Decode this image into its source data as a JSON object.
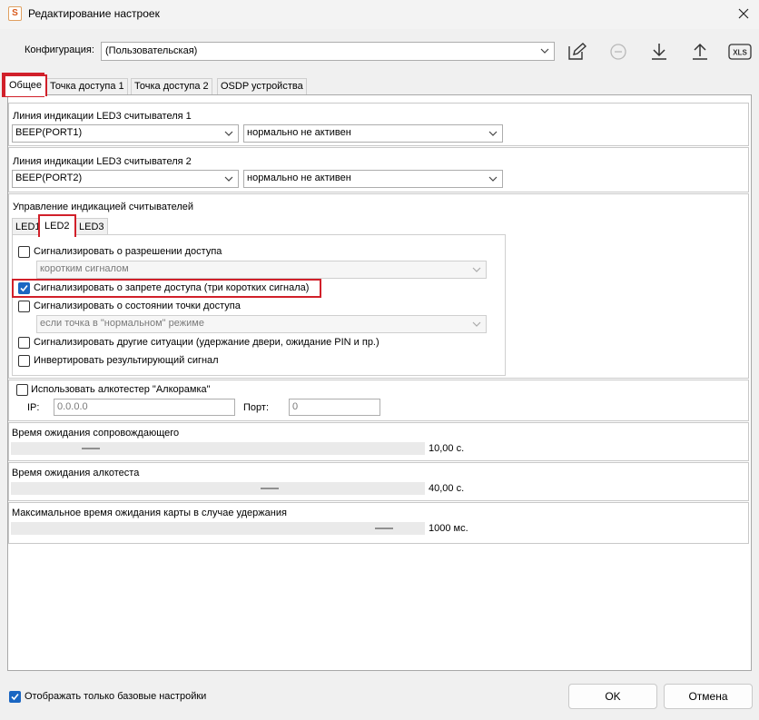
{
  "window": {
    "title": "Редактирование настроек",
    "icon_letter": "S"
  },
  "config": {
    "label": "Конфигурация:",
    "value": "(Пользовательская)"
  },
  "tabs": [
    {
      "label": "Общее"
    },
    {
      "label": "Точка доступа 1"
    },
    {
      "label": "Точка доступа 2"
    },
    {
      "label": "OSDP устройства"
    }
  ],
  "led_line1": {
    "label": "Линия индикации LED3 считывателя 1",
    "port": "BEEP(PORT1)",
    "state": "нормально не активен"
  },
  "led_line2": {
    "label": "Линия индикации LED3 считывателя 2",
    "port": "BEEP(PORT2)",
    "state": "нормально не активен"
  },
  "indication": {
    "label": "Управление индикацией считывателей",
    "subtabs": [
      {
        "label": "LED1"
      },
      {
        "label": "LED2"
      },
      {
        "label": "LED3"
      }
    ],
    "options": [
      {
        "label": "Сигнализировать о разрешении доступа",
        "checked": false
      },
      {
        "label": "Сигнализировать о запрете доступа (три коротких сигнала)",
        "checked": true
      },
      {
        "label": "Сигнализировать о состоянии точки доступа",
        "checked": false
      },
      {
        "label": "Сигнализировать другие ситуации (удержание двери, ожидание PIN и пр.)",
        "checked": false
      },
      {
        "label": "Инвертировать результирующий сигнал",
        "checked": false
      }
    ],
    "access_granted_mode": "коротким сигналом",
    "point_state_mode": "если точка в \"нормальном\" режиме"
  },
  "alco": {
    "checkbox_label": "Использовать алкотестер \"Алкорамка\"",
    "checked": false,
    "ip_label": "IP:",
    "ip_value": "0.0.0.0",
    "port_label": "Порт:",
    "port_value": "0"
  },
  "sliders": [
    {
      "label": "Время ожидания сопровождающего",
      "value": "10,00 с.",
      "level": 0.18
    },
    {
      "label": "Время ожидания алкотеста",
      "value": "40,00 с.",
      "level": 0.63
    },
    {
      "label": "Максимальное время ожидания карты в случае удержания",
      "value": "1000 мс.",
      "level": 0.92
    }
  ],
  "footer": {
    "basic_only_label": "Отображать только базовые настройки",
    "basic_only_checked": true,
    "ok_label": "OK",
    "cancel_label": "Отмена"
  },
  "colors": {
    "accent": "#1a66c2",
    "highlight": "#d1202a",
    "icon_orange": "#d9591b"
  }
}
